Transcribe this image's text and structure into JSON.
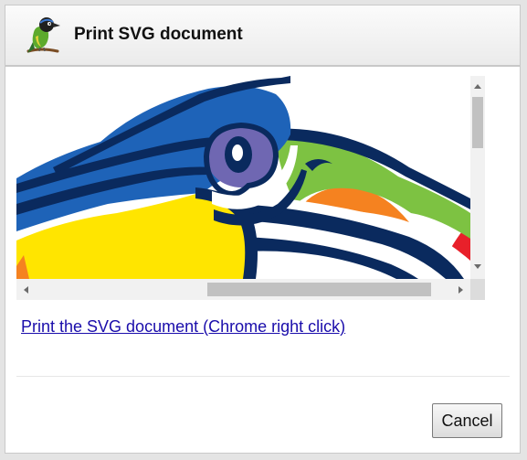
{
  "dialog": {
    "title": "Print SVG document",
    "icon": "bird-logo-icon"
  },
  "viewer": {
    "content": "toucan-illustration"
  },
  "link": {
    "label": "Print the SVG document (Chrome right click)"
  },
  "buttons": {
    "cancel_label": "Cancel"
  },
  "colors": {
    "link": "#1a0dab",
    "toucan_navy": "#0a2a5e",
    "toucan_blue": "#1e63b8",
    "toucan_yellow": "#ffe500",
    "toucan_green": "#7dc242",
    "toucan_orange": "#f58220",
    "toucan_red": "#e8202a",
    "toucan_purple": "#6f67b2"
  }
}
